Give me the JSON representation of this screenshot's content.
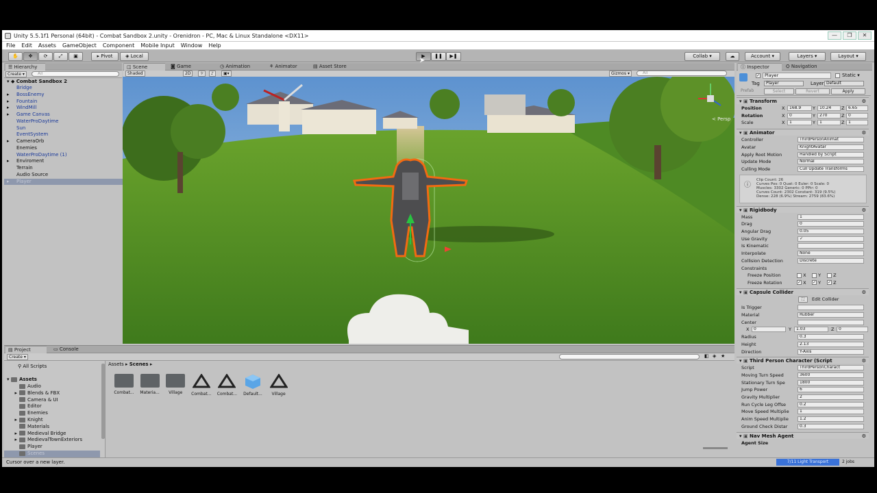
{
  "window": {
    "title": "Unity 5.5.1f1 Personal (64bit) - Combat Sandbox 2.unity - Orenidron - PC, Mac & Linux Standalone <DX11>",
    "controls": [
      "—",
      "❐",
      "✕"
    ]
  },
  "menu": [
    "File",
    "Edit",
    "Assets",
    "GameObject",
    "Component",
    "Mobile Input",
    "Window",
    "Help"
  ],
  "toolbar": {
    "pivot": "Pivot",
    "local": "Local",
    "collab": "Collab ▾",
    "account": "Account ▾",
    "layers": "Layers ▾",
    "layout": "Layout ▾"
  },
  "hierarchy": {
    "tab": "Hierarchy",
    "create": "Create ▾",
    "search_placeholder": "All",
    "scene": "Combat Sandbox 2",
    "items": [
      {
        "label": "Bridge",
        "prefab": true,
        "arrow": false
      },
      {
        "label": "BossEnemy",
        "prefab": true,
        "arrow": true
      },
      {
        "label": "Fountain",
        "prefab": true,
        "arrow": true
      },
      {
        "label": "WindMill",
        "prefab": true,
        "arrow": true
      },
      {
        "label": "Game Canvas",
        "prefab": true,
        "arrow": true
      },
      {
        "label": "WaterProDaytime",
        "prefab": true,
        "arrow": false
      },
      {
        "label": "Sun",
        "prefab": true,
        "arrow": false
      },
      {
        "label": "EventSystem",
        "prefab": true,
        "arrow": false
      },
      {
        "label": "CameraOrb",
        "prefab": false,
        "arrow": true
      },
      {
        "label": "Enemies",
        "prefab": false,
        "arrow": false
      },
      {
        "label": "WaterProDaytime (1)",
        "prefab": true,
        "arrow": false
      },
      {
        "label": "Enviroment",
        "prefab": false,
        "arrow": true
      },
      {
        "label": "Terrain",
        "prefab": false,
        "arrow": false
      },
      {
        "label": "Audio Source",
        "prefab": false,
        "arrow": false
      },
      {
        "label": "Player",
        "prefab": false,
        "arrow": true,
        "selected": true
      }
    ]
  },
  "scene_view": {
    "tabs": [
      "Scene",
      "Game",
      "Animation",
      "Animator",
      "Asset Store"
    ],
    "shading": "Shaded",
    "mode_2d": "2D",
    "gizmos": "Gizmos ▾",
    "search_placeholder": "All",
    "persp": "< Persp"
  },
  "inspector": {
    "tabs": [
      "Inspector",
      "Navigation"
    ],
    "object_name": "Player",
    "static": "Static ▾",
    "tag_label": "Tag",
    "tag": "Player",
    "layer_label": "Layer",
    "layer": "Default",
    "prefab_label": "Prefab",
    "prefab_buttons": [
      "Select",
      "Revert",
      "Apply"
    ],
    "transform": {
      "title": "Transform",
      "rows": [
        {
          "label": "Position",
          "x": "168.9",
          "y": "10.24",
          "z": "6.65"
        },
        {
          "label": "Rotation",
          "x": "0",
          "y": "270",
          "z": "0"
        },
        {
          "label": "Scale",
          "x": "1",
          "y": "1",
          "z": "1"
        }
      ]
    },
    "animator": {
      "title": "Animator",
      "rows": [
        {
          "label": "Controller",
          "value": "ThirdPersonAnimat"
        },
        {
          "label": "Avatar",
          "value": "KnightAvatar"
        },
        {
          "label": "Apply Root Motion",
          "value": "Handled by Script"
        },
        {
          "label": "Update Mode",
          "value": "Normal"
        },
        {
          "label": "Culling Mode",
          "value": "Cull Update Transforms"
        }
      ],
      "info": [
        "Clip Count: 26",
        "Curves Pos: 0 Quat: 0 Euler: 0 Scale: 0",
        "Muscles: 3302 Generic: 0 PPtr: 0",
        "Curves Count: 2302 Constant: 319 (9.5%)",
        "Dense: 228 (6.9%) Stream: 2759 (83.6%)"
      ]
    },
    "rigidbody": {
      "title": "Rigidbody",
      "rows": [
        {
          "label": "Mass",
          "value": "1"
        },
        {
          "label": "Drag",
          "value": "0"
        },
        {
          "label": "Angular Drag",
          "value": "0.05"
        },
        {
          "label": "Use Gravity",
          "value": "✓"
        },
        {
          "label": "Is Kinematic",
          "value": ""
        },
        {
          "label": "Interpolate",
          "value": "None"
        },
        {
          "label": "Collision Detection",
          "value": "Discrete"
        }
      ],
      "constraints": "Constraints",
      "freeze_position": "Freeze Position",
      "freeze_rotation": "Freeze Rotation",
      "axes": [
        "X",
        "Y",
        "Z"
      ]
    },
    "capsule": {
      "title": "Capsule Collider",
      "edit": "Edit Collider",
      "rows": [
        {
          "label": "Is Trigger",
          "value": ""
        },
        {
          "label": "Material",
          "value": "Rubber"
        },
        {
          "label": "Center",
          "value": ""
        },
        {
          "label": "Radius",
          "value": "0.3"
        },
        {
          "label": "Height",
          "value": "2.13"
        },
        {
          "label": "Direction",
          "value": "Y-Axis"
        }
      ],
      "center": {
        "x": "0",
        "y": "1.03",
        "z": "0"
      }
    },
    "third_person": {
      "title": "Third Person Character (Script",
      "rows": [
        {
          "label": "Script",
          "value": "ThirdPersonCharact"
        },
        {
          "label": "Moving Turn Speed",
          "value": "3600"
        },
        {
          "label": "Stationary Turn Spe",
          "value": "1800"
        },
        {
          "label": "Jump Power",
          "value": "6"
        },
        {
          "label": "Gravity Multiplier",
          "value": "2"
        },
        {
          "label": "Run Cycle Leg Offse",
          "value": "0.2"
        },
        {
          "label": "Move Speed Multiplie",
          "value": "1"
        },
        {
          "label": "Anim Speed Multiplie",
          "value": "1.2"
        },
        {
          "label": "Ground Check Distar",
          "value": "0.3"
        }
      ]
    },
    "nav_mesh": {
      "title": "Nav Mesh Agent",
      "agent_size": "Agent Size"
    }
  },
  "project": {
    "tabs": [
      "Project",
      "Console"
    ],
    "create": "Create ▾",
    "all_scripts": "All Scripts",
    "assets_root": "Assets",
    "tree": [
      "Audio",
      "Blends & FBX",
      "Camera & UI",
      "Editor",
      "Enemies",
      "Knight",
      "Materials",
      "Medieval Bridge",
      "MedievalTownExteriors",
      "Player",
      "Scenes"
    ],
    "breadcrumb": [
      "Assets",
      "Scenes"
    ],
    "files": [
      {
        "label": "Combat...",
        "type": "folder"
      },
      {
        "label": "Materia...",
        "type": "folder"
      },
      {
        "label": "Village",
        "type": "folder"
      },
      {
        "label": "Combat...",
        "type": "scene"
      },
      {
        "label": "Combat...",
        "type": "scene"
      },
      {
        "label": "Default...",
        "type": "cube"
      },
      {
        "label": "Village",
        "type": "scene"
      }
    ]
  },
  "status": {
    "message": "Cursor over a new layer.",
    "progress": "7/11 Light Transport",
    "jobs": "2 jobs"
  },
  "colors": {
    "selection": "#3a72d8",
    "outline": "#f26a12",
    "prefab_text": "#1b3a9a"
  }
}
